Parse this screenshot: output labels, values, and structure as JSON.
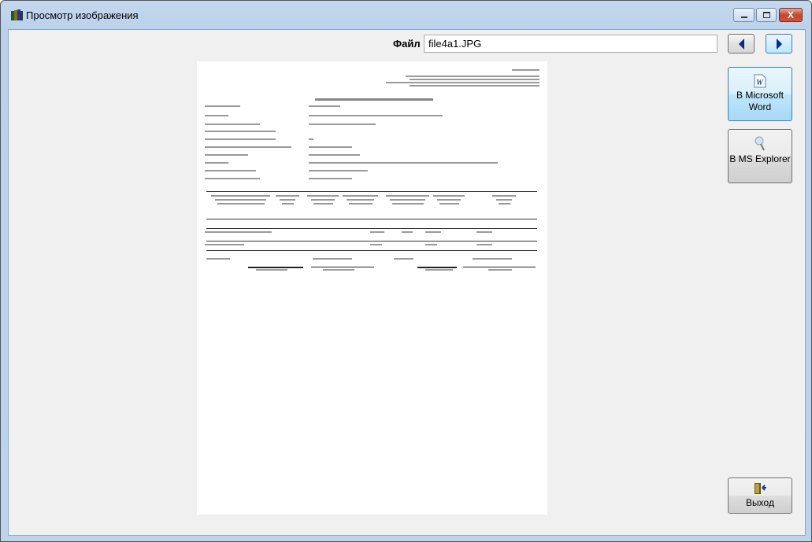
{
  "window": {
    "title": "Просмотр изображения",
    "controls": {
      "close": "X"
    }
  },
  "file": {
    "label": "Файл",
    "value": "file4a1.JPG"
  },
  "buttons": {
    "word": "В Microsoft Word",
    "explorer": "В MS Explorer",
    "exit": "Выход"
  }
}
